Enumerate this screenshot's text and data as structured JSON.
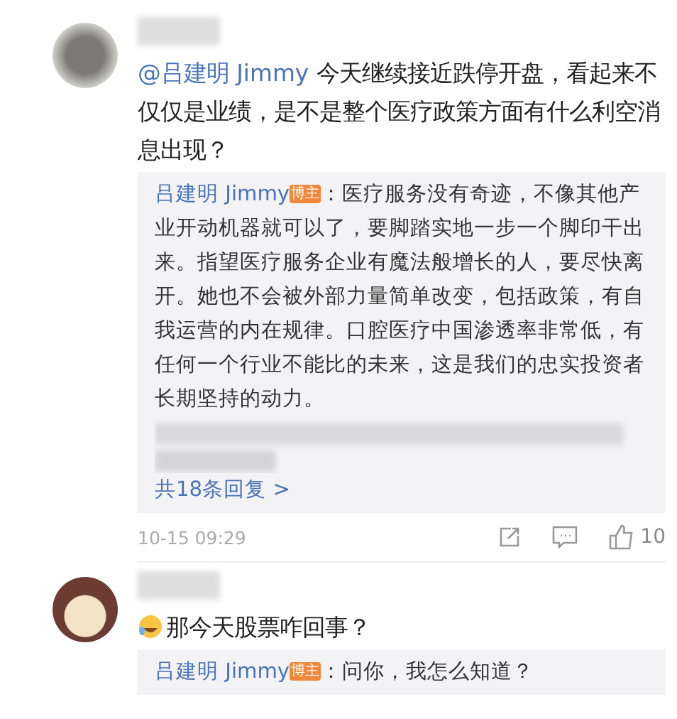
{
  "comments": [
    {
      "mention": "@吕建明 Jimmy",
      "text": "今天继续接近跌停开盘，看起来不仅仅是业绩，是不是整个医疗政策方面有什么利空消息出现？",
      "emoji": false,
      "replies": [
        {
          "kind": "reply",
          "author": "吕建明 Jimmy",
          "badge": "博主",
          "text": "：医疗服务没有奇迹，不像其他产业开动机器就可以了，要脚踏实地一步一个脚印干出来。指望医疗服务企业有魔法般增长的人，要尽快离开。她也不会被外部力量简单改变，包括政策，有自我运营的内在规律。口腔医疗中国渗透率非常低，有任何一个行业不能比的未来，这是我们的忠实投资者长期坚持的动力。"
        },
        {
          "kind": "redacted"
        }
      ],
      "more_replies": "共18条回复 >",
      "time": "10-15 09:29",
      "likes": "10"
    },
    {
      "emoji": true,
      "text": "那今天股票咋回事？",
      "replies": [
        {
          "kind": "reply",
          "author": "吕建明 Jimmy",
          "badge": "博主",
          "text": "：问你，我怎么知道？"
        }
      ]
    }
  ]
}
